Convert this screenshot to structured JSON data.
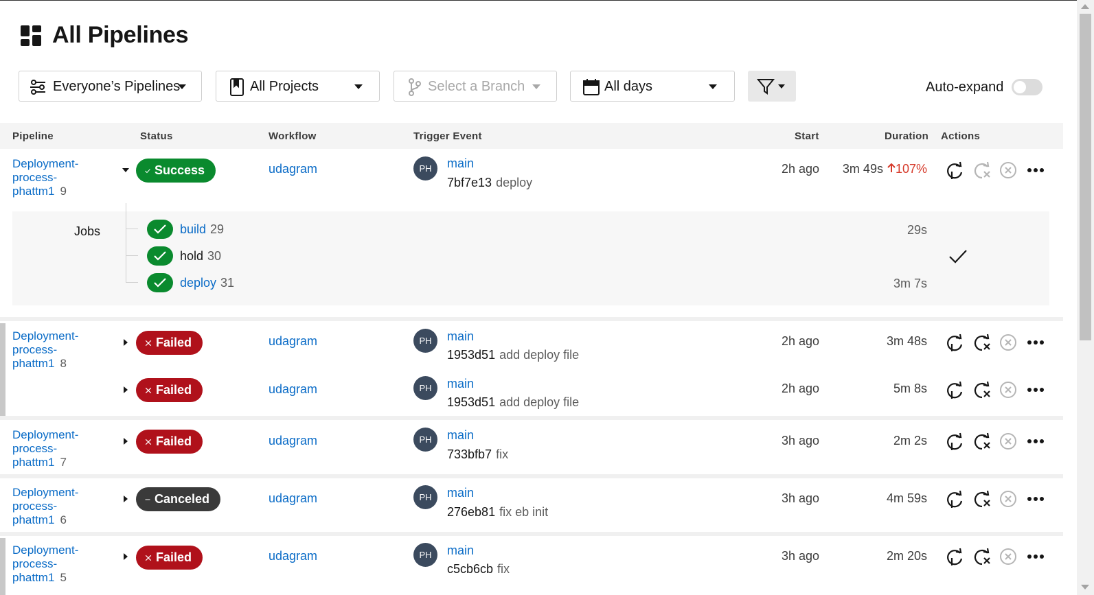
{
  "header": {
    "title": "All Pipelines",
    "icon": "dashboard-grid-icon"
  },
  "filters": {
    "owner": "Everyone’s Pipelines",
    "project": "All Projects",
    "branch_placeholder": "Select a Branch",
    "days": "All days",
    "auto_expand_label": "Auto-expand",
    "auto_expand_on": false
  },
  "columns": [
    "Pipeline",
    "Status",
    "Workflow",
    "Trigger Event",
    "Start",
    "Duration",
    "Actions"
  ],
  "pipelines": [
    {
      "name": "Deployment-process-phattm1",
      "number": "9",
      "status": "Success",
      "workflow": "udagram",
      "avatar": "PH",
      "branch": "main",
      "sha": "7bf7e13",
      "message": "deploy",
      "start": "2h ago",
      "duration": "3m 49s",
      "duration_change": "107%",
      "jobs_label": "Jobs",
      "jobs": [
        {
          "name": "build",
          "number": "29",
          "duration": "29s"
        },
        {
          "name": "hold",
          "number": "30",
          "duration": ""
        },
        {
          "name": "deploy",
          "number": "31",
          "duration": "3m 7s"
        }
      ]
    },
    {
      "name": "Deployment-process-phattm1",
      "number": "8",
      "workflows": [
        {
          "status": "Failed",
          "workflow": "udagram",
          "avatar": "PH",
          "branch": "main",
          "sha": "1953d51",
          "message": "add deploy file",
          "start": "2h ago",
          "duration": "3m 48s"
        },
        {
          "status": "Failed",
          "workflow": "udagram",
          "avatar": "PH",
          "branch": "main",
          "sha": "1953d51",
          "message": "add deploy file",
          "start": "2h ago",
          "duration": "5m 8s"
        }
      ]
    },
    {
      "name": "Deployment-process-phattm1",
      "number": "7",
      "status": "Failed",
      "workflow": "udagram",
      "avatar": "PH",
      "branch": "main",
      "sha": "733bfb7",
      "message": "fix",
      "start": "3h ago",
      "duration": "2m 2s"
    },
    {
      "name": "Deployment-process-phattm1",
      "number": "6",
      "status": "Canceled",
      "workflow": "udagram",
      "avatar": "PH",
      "branch": "main",
      "sha": "276eb81",
      "message": "fix eb init",
      "start": "3h ago",
      "duration": "4m 59s"
    },
    {
      "name": "Deployment-process-phattm1",
      "number": "5",
      "status": "Failed",
      "workflow": "udagram",
      "avatar": "PH",
      "branch": "main",
      "sha": "c5cb6cb",
      "message": "fix",
      "start": "3h ago",
      "duration": "2m 20s"
    }
  ],
  "colors": {
    "link": "#0b6cc7",
    "success": "#0a8a2e",
    "failed": "#b0111b",
    "canceled": "#3a3a3a",
    "increase": "#d63a2a"
  }
}
